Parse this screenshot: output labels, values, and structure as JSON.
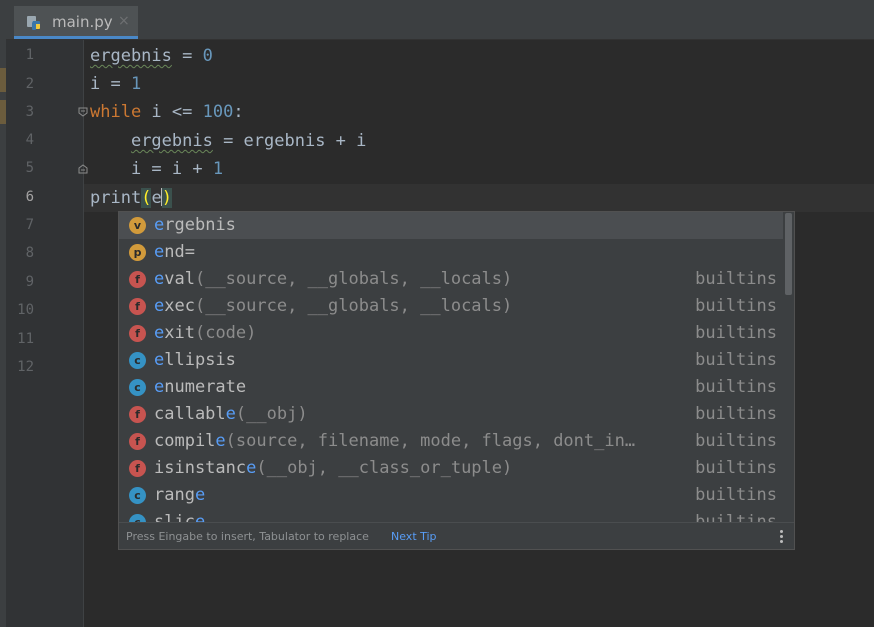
{
  "tab": {
    "label": "main.py",
    "icon": "python-file-icon",
    "close": "×"
  },
  "gutter": {
    "line_numbers": [
      "1",
      "2",
      "3",
      "4",
      "5",
      "6",
      "7",
      "8",
      "9",
      "10",
      "11",
      "12"
    ],
    "current_line": "6"
  },
  "code": {
    "line1": {
      "var": "ergebnis",
      "rest": " = ",
      "num": "0"
    },
    "line2": {
      "text": "i = ",
      "num": "1"
    },
    "line3": {
      "kw": "while",
      "rest": " i <= ",
      "num": "100",
      "end": ":"
    },
    "line4": {
      "indent": "    ",
      "var": "ergebnis",
      "rest": " = ergebnis + i"
    },
    "line5": {
      "text": "    i = i + ",
      "num": "1"
    },
    "line6": {
      "fn": "print",
      "open": "(",
      "typed": "e",
      "close": ")"
    }
  },
  "completion": {
    "items": [
      {
        "icon": "v",
        "match": "e",
        "rest": "rgebnis",
        "sig": "",
        "source": ""
      },
      {
        "icon": "p",
        "match": "e",
        "rest": "nd=",
        "sig": "",
        "source": ""
      },
      {
        "icon": "f",
        "match": "e",
        "rest": "val",
        "sig": "(__source, __globals, __locals)",
        "source": "builtins"
      },
      {
        "icon": "f",
        "match": "e",
        "rest": "xec",
        "sig": "(__source, __globals, __locals)",
        "source": "builtins"
      },
      {
        "icon": "f",
        "match": "e",
        "rest": "xit",
        "sig": "(code)",
        "source": "builtins"
      },
      {
        "icon": "c",
        "match": "e",
        "rest": "llipsis",
        "sig": "",
        "source": "builtins"
      },
      {
        "icon": "c",
        "match": "e",
        "rest": "numerate",
        "sig": "",
        "source": "builtins"
      },
      {
        "icon": "f",
        "pre": "callabl",
        "match": "e",
        "sig": "(__obj)",
        "source": "builtins"
      },
      {
        "icon": "f",
        "pre": "compil",
        "match": "e",
        "sig": "(source, filename, mode, flags, dont_in…",
        "source": "builtins"
      },
      {
        "icon": "f",
        "pre": "isinstanc",
        "match": "e",
        "sig": "(__obj, __class_or_tuple)",
        "source": "builtins"
      },
      {
        "icon": "c",
        "pre": "rang",
        "match": "e",
        "sig": "",
        "source": "builtins"
      },
      {
        "icon": "c",
        "pre": "slic",
        "match": "e",
        "sig": "",
        "source": "builtins"
      }
    ],
    "footer": {
      "hint": "Press Eingabe to insert, Tabulator to replace",
      "next_tip": "Next Tip"
    }
  }
}
